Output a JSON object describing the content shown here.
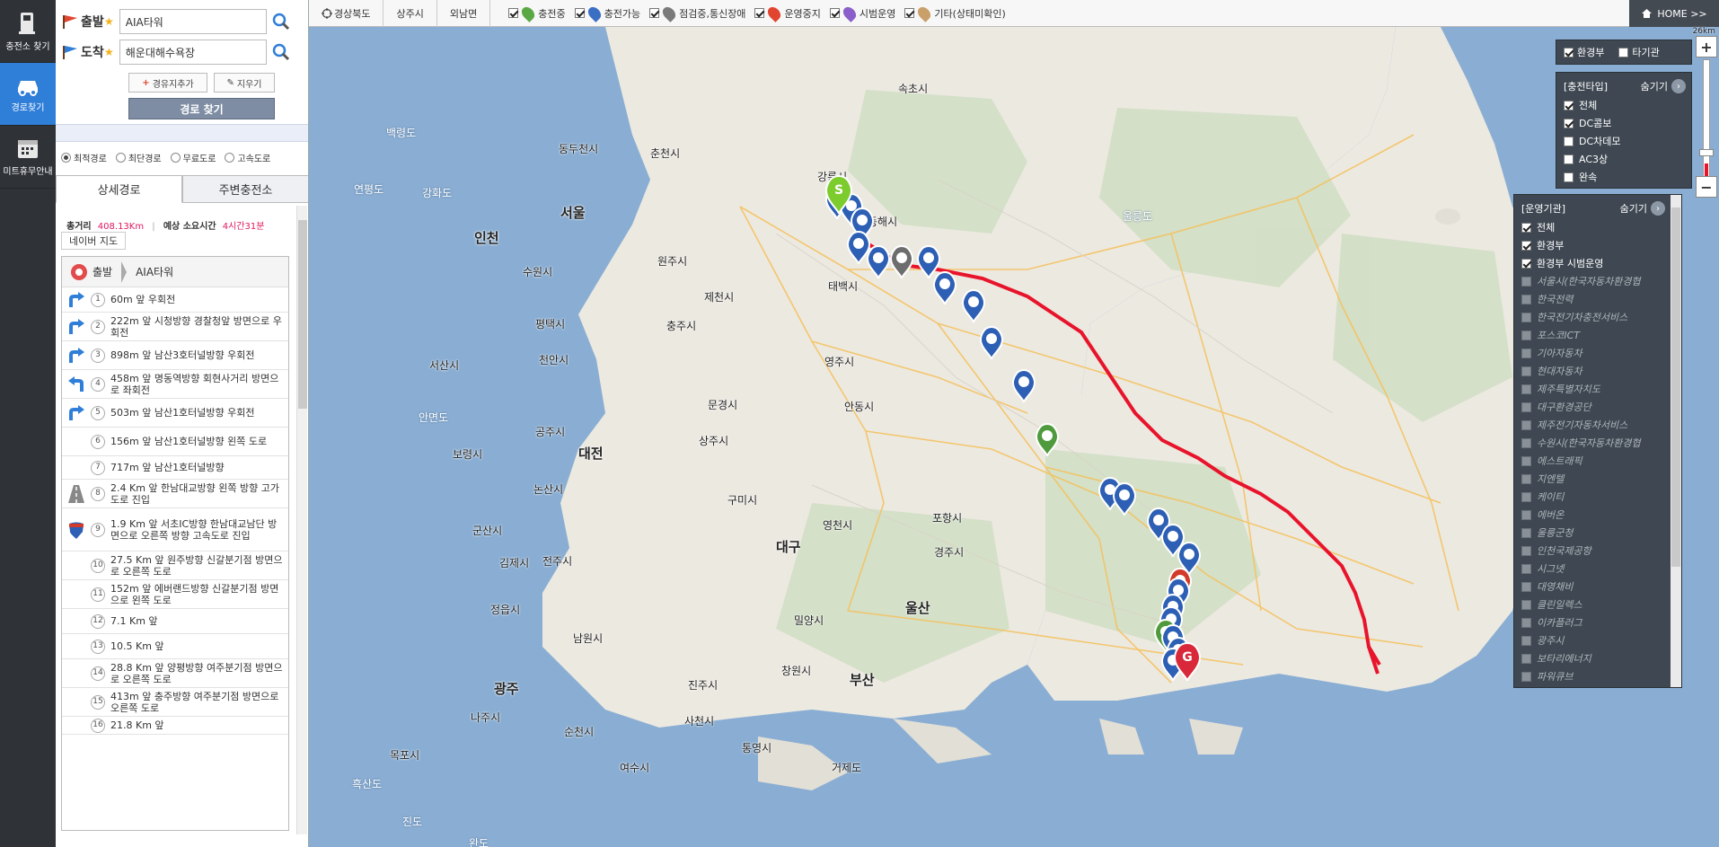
{
  "rail": {
    "items": [
      {
        "label": "충전소 찾기"
      },
      {
        "label": "경로찾기"
      },
      {
        "label": "미트휴무안내"
      }
    ]
  },
  "route_form": {
    "start_label": "출발",
    "start_value": "AIA타워",
    "end_label": "도착",
    "end_value": "해운대해수욕장",
    "waypoint_btn": "경유지추가",
    "clear_btn": "지우기",
    "find_btn": "경로 찾기",
    "options": [
      {
        "label": "최적경로",
        "selected": true
      },
      {
        "label": "최단경로",
        "selected": false
      },
      {
        "label": "무료도로",
        "selected": false
      },
      {
        "label": "고속도로",
        "selected": false
      }
    ]
  },
  "tabs": [
    {
      "label": "상세경로",
      "active": true
    },
    {
      "label": "주변충전소",
      "active": false
    }
  ],
  "summary": {
    "distance_label": "총거리",
    "distance": "408.13Km",
    "time_label": "예상 소요시간",
    "time": "4시간31분",
    "source_tag": "네이버 지도"
  },
  "steps": {
    "start_label": "출발",
    "start_place": "AIA타워",
    "items": [
      {
        "n": "1",
        "icon": "turn-right",
        "text": "60m 앞 우회전"
      },
      {
        "n": "2",
        "icon": "turn-right",
        "text": "222m 앞 시청방향 경찰청앞 방면으로 우회전"
      },
      {
        "n": "3",
        "icon": "turn-right",
        "text": "898m 앞 남산3호터널방향 우회전"
      },
      {
        "n": "4",
        "icon": "turn-left",
        "text": "458m 앞 명동역방향 회현사거리 방면으로 좌회전"
      },
      {
        "n": "5",
        "icon": "turn-right",
        "text": "503m 앞 남산1호터널방향 우회전"
      },
      {
        "n": "6",
        "icon": "none",
        "text": "156m 앞 남산1호터널방향 왼쪽 도로"
      },
      {
        "n": "7",
        "icon": "none",
        "text": "717m 앞 남산1호터널방향"
      },
      {
        "n": "8",
        "icon": "road",
        "text": "2.4 Km 앞 한남대교방향 왼쪽 방향 고가도로 진입"
      },
      {
        "n": "9",
        "icon": "highway",
        "text": "1.9 Km 앞 서초IC방향 한남대교남단 방면으로 오른쪽 방향 고속도로 진입"
      },
      {
        "n": "10",
        "icon": "none",
        "text": "27.5 Km 앞 원주방향 신갈분기점 방면으로 오른쪽 도로"
      },
      {
        "n": "11",
        "icon": "none",
        "text": "152m 앞 에버랜드방향 신갈분기점 방면으로 왼쪽 도로"
      },
      {
        "n": "12",
        "icon": "none",
        "text": "7.1 Km 앞"
      },
      {
        "n": "13",
        "icon": "none",
        "text": "10.5 Km 앞"
      },
      {
        "n": "14",
        "icon": "none",
        "text": "28.8 Km 앞 양평방향 여주분기점 방면으로 오른쪽 도로"
      },
      {
        "n": "15",
        "icon": "none",
        "text": "413m 앞 충주방향 여주분기점 방면으로 오른쪽 도로"
      },
      {
        "n": "16",
        "icon": "none",
        "text": "21.8 Km 앞"
      }
    ]
  },
  "map_topbar": {
    "breadcrumbs": [
      "경상북도",
      "상주시",
      "외남면"
    ],
    "filters": [
      {
        "label": "충전중",
        "color": "#5aa844"
      },
      {
        "label": "충전가능",
        "color": "#3b6fc4"
      },
      {
        "label": "점검중,통신장애",
        "color": "#7a7a7a"
      },
      {
        "label": "운영중지",
        "color": "#e2452f"
      },
      {
        "label": "시범운영",
        "color": "#8a5fc9"
      },
      {
        "label": "기타(상태미확인)",
        "color": "#c9a06a"
      }
    ],
    "home": "HOME >>"
  },
  "layer_panel": {
    "items": [
      {
        "label": "환경부",
        "checked": true
      },
      {
        "label": "타기관",
        "checked": false
      }
    ]
  },
  "charge_type_panel": {
    "title": "[충전타입]",
    "hide": "숨기기",
    "items": [
      {
        "label": "전체",
        "checked": true
      },
      {
        "label": "DC콤보",
        "checked": true
      },
      {
        "label": "DC차데모",
        "checked": false
      },
      {
        "label": "AC3상",
        "checked": false
      },
      {
        "label": "완속",
        "checked": false
      }
    ]
  },
  "operator_panel": {
    "title": "[운영기관]",
    "hide": "숨기기",
    "items": [
      {
        "label": "전체",
        "checked": true,
        "enabled": true
      },
      {
        "label": "환경부",
        "checked": true,
        "enabled": true
      },
      {
        "label": "환경부 시범운영",
        "checked": true,
        "enabled": true
      },
      {
        "label": "서울시(한국자동차환경협",
        "checked": false,
        "enabled": false
      },
      {
        "label": "한국전력",
        "checked": false,
        "enabled": false
      },
      {
        "label": "한국전기차충전서비스",
        "checked": false,
        "enabled": false
      },
      {
        "label": "포스코ICT",
        "checked": false,
        "enabled": false
      },
      {
        "label": "기아자동차",
        "checked": false,
        "enabled": false
      },
      {
        "label": "현대자동차",
        "checked": false,
        "enabled": false
      },
      {
        "label": "제주특별자치도",
        "checked": false,
        "enabled": false
      },
      {
        "label": "대구환경공단",
        "checked": false,
        "enabled": false
      },
      {
        "label": "제주전기자동차서비스",
        "checked": false,
        "enabled": false
      },
      {
        "label": "수원시(한국자동차환경협",
        "checked": false,
        "enabled": false
      },
      {
        "label": "에스트래픽",
        "checked": false,
        "enabled": false
      },
      {
        "label": "지엔텔",
        "checked": false,
        "enabled": false
      },
      {
        "label": "케이티",
        "checked": false,
        "enabled": false
      },
      {
        "label": "에버온",
        "checked": false,
        "enabled": false
      },
      {
        "label": "울릉군청",
        "checked": false,
        "enabled": false
      },
      {
        "label": "인천국제공항",
        "checked": false,
        "enabled": false
      },
      {
        "label": "시그넷",
        "checked": false,
        "enabled": false
      },
      {
        "label": "대영채비",
        "checked": false,
        "enabled": false
      },
      {
        "label": "클린일렉스",
        "checked": false,
        "enabled": false
      },
      {
        "label": "이카플러그",
        "checked": false,
        "enabled": false
      },
      {
        "label": "광주시",
        "checked": false,
        "enabled": false
      },
      {
        "label": "보타리에너지",
        "checked": false,
        "enabled": false
      },
      {
        "label": "파워큐브",
        "checked": false,
        "enabled": false
      }
    ]
  },
  "map_scale": "26km",
  "cities": [
    {
      "name": "속초시"
    },
    {
      "name": "백령도"
    },
    {
      "name": "동두천시"
    },
    {
      "name": "춘천시"
    },
    {
      "name": "강릉시"
    },
    {
      "name": "연평도"
    },
    {
      "name": "강화도"
    },
    {
      "name": "서울"
    },
    {
      "name": "동해시"
    },
    {
      "name": "울릉도"
    },
    {
      "name": "인천"
    },
    {
      "name": "원주시"
    },
    {
      "name": "수원시"
    },
    {
      "name": "태백시"
    },
    {
      "name": "제천시"
    },
    {
      "name": "평택시"
    },
    {
      "name": "충주시"
    },
    {
      "name": "서산시"
    },
    {
      "name": "천안시"
    },
    {
      "name": "영주시"
    },
    {
      "name": "안면도"
    },
    {
      "name": "문경시"
    },
    {
      "name": "안동시"
    },
    {
      "name": "공주시"
    },
    {
      "name": "상주시"
    },
    {
      "name": "보령시"
    },
    {
      "name": "대전"
    },
    {
      "name": "논산시"
    },
    {
      "name": "구미시"
    },
    {
      "name": "포항시"
    },
    {
      "name": "군산시"
    },
    {
      "name": "영천시"
    },
    {
      "name": "대구"
    },
    {
      "name": "김제시"
    },
    {
      "name": "전주시"
    },
    {
      "name": "경주시"
    },
    {
      "name": "울산"
    },
    {
      "name": "정읍시"
    },
    {
      "name": "밀양시"
    },
    {
      "name": "남원시"
    },
    {
      "name": "광주"
    },
    {
      "name": "창원시"
    },
    {
      "name": "진주시"
    },
    {
      "name": "부산"
    },
    {
      "name": "나주시"
    },
    {
      "name": "사천시"
    },
    {
      "name": "순천시"
    },
    {
      "name": "통영시"
    },
    {
      "name": "목포시"
    },
    {
      "name": "여수시"
    },
    {
      "name": "거제도"
    },
    {
      "name": "흑산도"
    },
    {
      "name": "진도"
    },
    {
      "name": "완도"
    }
  ]
}
